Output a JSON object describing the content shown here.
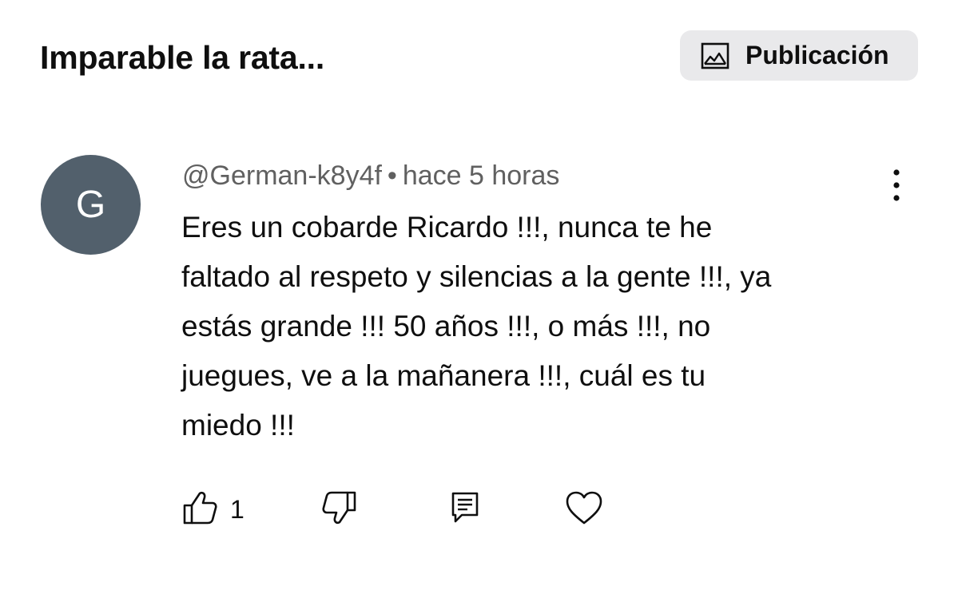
{
  "header": {
    "title": "Imparable la rata...",
    "publication_button": {
      "label": "Publicación",
      "icon": "image-icon"
    }
  },
  "comment": {
    "avatar_letter": "G",
    "avatar_color": "#52606c",
    "author": "@German-k8y4f",
    "separator": "•",
    "timestamp": "hace 5 horas",
    "text": "Eres un cobarde Ricardo !!!, nunca te he\nfaltado al respeto y silencias a la gente !!!, ya\nestás grande !!! 50 años !!!, o más !!!, no\njuegues, ve a la mañanera !!!, cuál es tu\nmiedo !!!",
    "more_icon": "more-vert-icon",
    "actions": {
      "like_icon": "thumbs-up-icon",
      "like_count": "1",
      "dislike_icon": "thumbs-down-icon",
      "reply_icon": "reply-comment-icon",
      "heart_icon": "heart-icon"
    }
  }
}
